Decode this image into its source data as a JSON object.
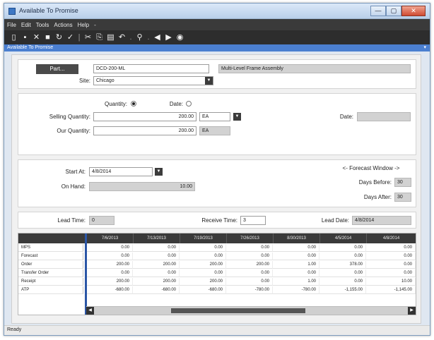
{
  "window": {
    "title": "Available To Promise",
    "controls": {
      "minimize": "—",
      "maximize": "▢",
      "close": "✕"
    }
  },
  "menu": [
    "File",
    "Edit",
    "Tools",
    "Actions",
    "Help",
    "-"
  ],
  "toolbar": {
    "icons": [
      "new-icon",
      "save-icon",
      "delete-icon",
      "stop-icon",
      "refresh-icon",
      "check-icon",
      "cut-icon",
      "copy-icon",
      "paste-icon",
      "undo-icon",
      "binoculars-icon",
      "back-icon",
      "forward-icon",
      "home-icon"
    ]
  },
  "panel": {
    "title": "Available To Promise",
    "pin": "▾"
  },
  "part": {
    "button_label": "Part...",
    "value": "DCD-200-ML",
    "description": "Multi-Level Frame Assembly"
  },
  "site": {
    "label": "Site:",
    "value": "Chicago"
  },
  "mode": {
    "quantity_label": "Quantity:",
    "date_label": "Date:",
    "selected": "quantity"
  },
  "selling_quantity": {
    "label": "Selling Quantity:",
    "value": "200.00",
    "uom": "EA"
  },
  "our_quantity": {
    "label": "Our Quantity:",
    "value": "200.00",
    "uom": "EA"
  },
  "date_field": {
    "label": "Date:",
    "value": ""
  },
  "start_at": {
    "label": "Start At:",
    "value": "4/8/2014"
  },
  "on_hand": {
    "label": "On Hand:",
    "value": "10.00"
  },
  "forecast_window": {
    "title": "<- Forecast Window ->",
    "days_before_label": "Days Before:",
    "days_before": "30",
    "days_after_label": "Days After:",
    "days_after": "30"
  },
  "lead_time": {
    "label": "Lead Time:",
    "value": "0"
  },
  "receive_time": {
    "label": "Receive Time:",
    "value": "3"
  },
  "lead_date": {
    "label": "Lead Date:",
    "value": "4/8/2014"
  },
  "grid": {
    "columns": [
      "7/6/2013",
      "7/13/2013",
      "7/19/2013",
      "7/26/2013",
      "8/30/2013",
      "4/5/2014",
      "4/8/2014"
    ],
    "rows": [
      {
        "label": "MPS",
        "values": [
          "0.00",
          "0.00",
          "0.00",
          "0.00",
          "0.00",
          "0.00",
          "0.00"
        ]
      },
      {
        "label": "Forecast",
        "values": [
          "0.00",
          "0.00",
          "0.00",
          "0.00",
          "0.00",
          "0.00",
          "0.00"
        ]
      },
      {
        "label": "Order",
        "values": [
          "200.00",
          "200.00",
          "200.00",
          "200.00",
          "1.00",
          "378.00",
          "0.00"
        ]
      },
      {
        "label": "Transfer Order",
        "values": [
          "0.00",
          "0.00",
          "0.00",
          "0.00",
          "0.00",
          "0.00",
          "0.00"
        ]
      },
      {
        "label": "Receipt",
        "values": [
          "200.00",
          "200.00",
          "200.00",
          "0.00",
          "1.00",
          "0.00",
          "10.00"
        ]
      },
      {
        "label": "ATP",
        "values": [
          "-680.00",
          "-680.00",
          "-680.00",
          "-780.00",
          "-780.00",
          "-1,155.00",
          "-1,145.00"
        ]
      }
    ]
  },
  "status": {
    "text": "Ready"
  },
  "colors": {
    "caption": "#4b7fd0",
    "menubar": "#3a3a3a",
    "toolbar": "#2d2d2d",
    "grid_divider": "#2b56a6"
  }
}
